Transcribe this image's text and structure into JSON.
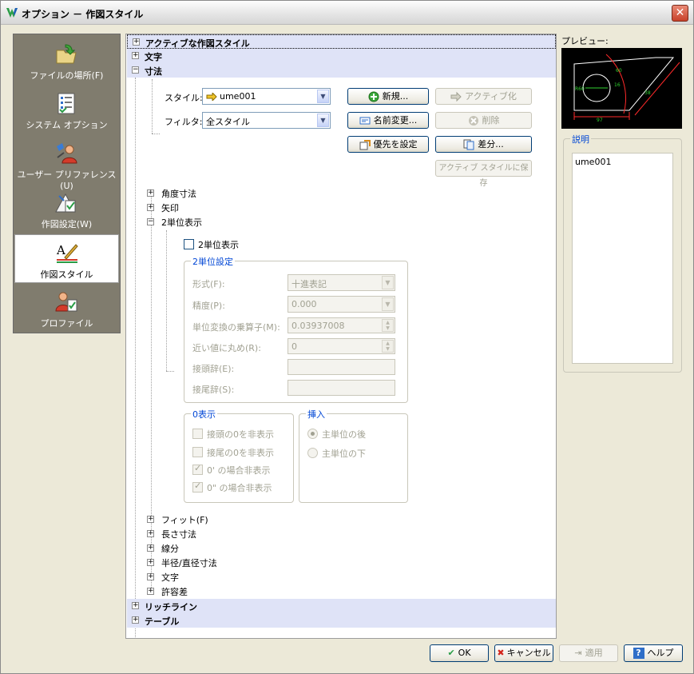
{
  "window": {
    "title": "オプション － 作図スタイル",
    "close": "✕"
  },
  "nav": [
    {
      "label": "ファイルの場所(F)",
      "icon": "folder-arrow-icon"
    },
    {
      "label": "システム オプション",
      "icon": "checklist-icon"
    },
    {
      "label": "ユーザー プリファレンス(U)",
      "icon": "user-preferences-icon"
    },
    {
      "label": "作図設定(W)",
      "icon": "drafting-settings-icon"
    },
    {
      "label": "作図スタイル",
      "icon": "drawing-style-icon",
      "selected": true
    },
    {
      "label": "プロファイル",
      "icon": "profile-icon"
    }
  ],
  "categories": {
    "active": "アクティブな作図スタイル",
    "text": "文字",
    "dimension": "寸法",
    "leader": "リッチライン",
    "table": "テーブル"
  },
  "style_section": {
    "style_label": "スタイル:",
    "style_value": "ume001",
    "filter_label": "フィルタ:",
    "filter_value": "全スタイル",
    "new_btn": "新規...",
    "rename_btn": "名前変更...",
    "override_btn": "優先を設定",
    "activate_btn": "アクティブ化",
    "delete_btn": "削除",
    "diff_btn": "差分...",
    "save_active_btn": "アクティブ スタイルに保存"
  },
  "tree": {
    "angular": "角度寸法",
    "arrow": "矢印",
    "alt_units": "2単位表示",
    "fit": "フィット(F)",
    "linear": "長さ寸法",
    "line": "線分",
    "radius": "半径/直径寸法",
    "text": "文字",
    "tolerance": "許容差"
  },
  "alt_units": {
    "enable_label": "2単位表示",
    "settings_title": "2単位設定",
    "format_label": "形式(F):",
    "format_value": "十進表記",
    "precision_label": "精度(P):",
    "precision_value": "0.000",
    "multiplier_label": "単位変換の乗算子(M):",
    "multiplier_value": "0.03937008",
    "round_label": "近い値に丸め(R):",
    "round_value": "0",
    "prefix_label": "接頭辞(E):",
    "suffix_label": "接尾辞(S):",
    "zero_title": "0表示",
    "zero_leading": "接頭の0を非表示",
    "zero_trailing": "接尾の0を非表示",
    "zero_feet": "0' の場合非表示",
    "zero_inches": "0\" の場合非表示",
    "placement_title": "挿入",
    "after_primary": "主単位の後",
    "below_primary": "主単位の下"
  },
  "right": {
    "preview_label": "プレビュー:",
    "desc_title": "説明",
    "desc_value": "ume001"
  },
  "preview_labels": {
    "a": "R60",
    "b": "97",
    "c": "16",
    "d": "60",
    "e": "38"
  },
  "footer": {
    "ok": "OK",
    "cancel": "キャンセル",
    "apply": "適用",
    "help": "ヘルプ"
  }
}
